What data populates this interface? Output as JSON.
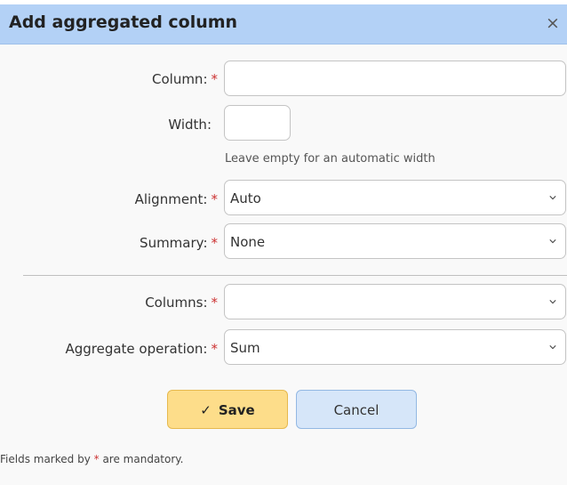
{
  "dialog": {
    "title": "Add aggregated column",
    "close_glyph": "×"
  },
  "required_marker": "*",
  "form": {
    "column": {
      "label": "Column:",
      "value": ""
    },
    "width": {
      "label": "Width:",
      "value": "",
      "hint": "Leave empty for an automatic width"
    },
    "alignment": {
      "label": "Alignment:",
      "value": "Auto"
    },
    "summary": {
      "label": "Summary:",
      "value": "None"
    },
    "columns": {
      "label": "Columns:",
      "value": ""
    },
    "aggregate_operation": {
      "label": "Aggregate operation:",
      "value": "Sum"
    }
  },
  "buttons": {
    "save_icon": "✓",
    "save_label": "Save",
    "cancel_label": "Cancel"
  },
  "footer": {
    "prefix": "Fields marked by",
    "suffix": "are mandatory."
  },
  "icons": {
    "close": "close-icon",
    "chevron": "chevron-down-icon",
    "check": "check-icon"
  },
  "colors": {
    "header_bg": "#b3d1f6",
    "required": "#cc3333",
    "save_bg": "#fddd8a",
    "cancel_bg": "#d6e6f9"
  }
}
